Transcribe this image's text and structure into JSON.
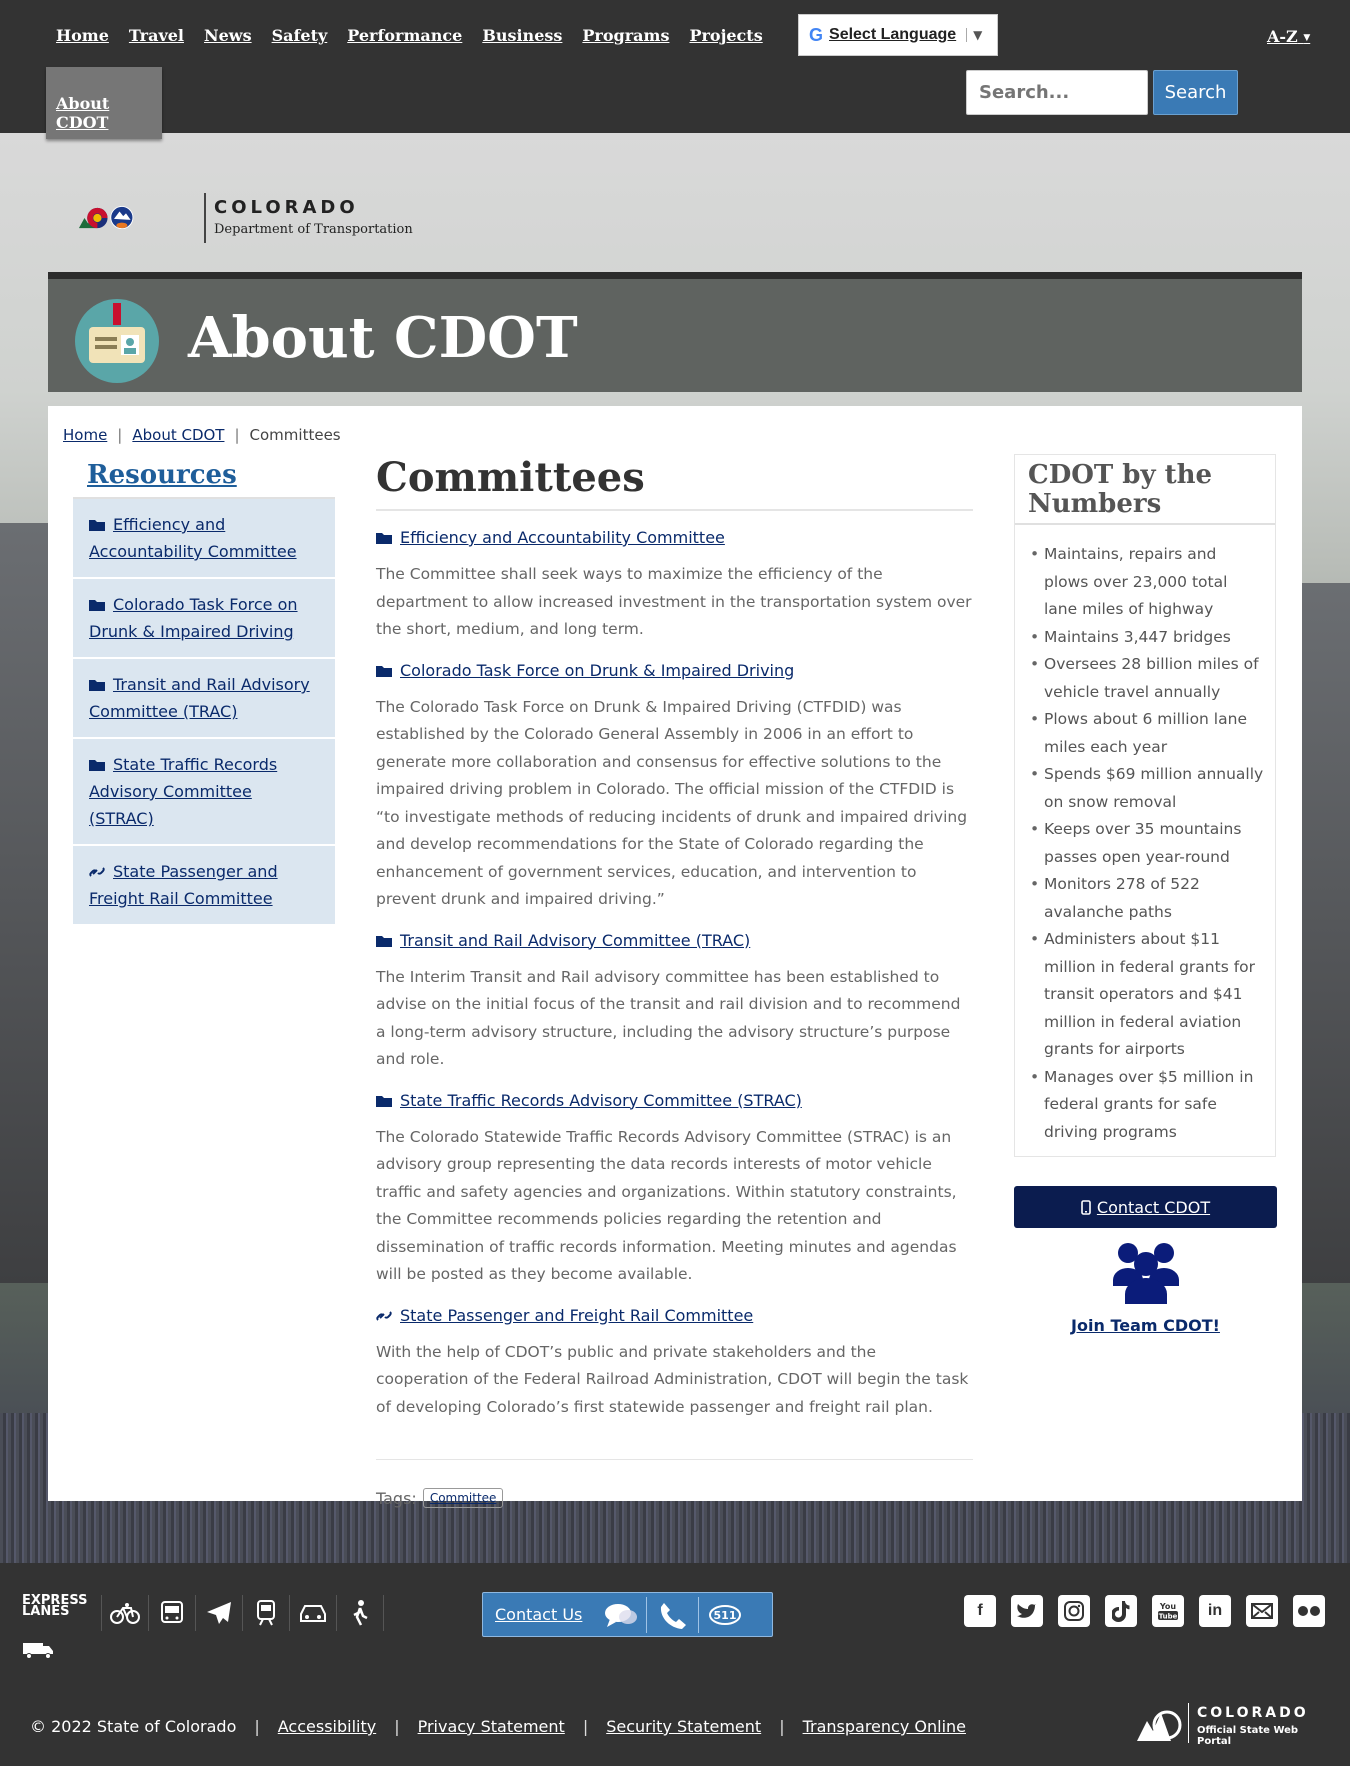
{
  "nav": {
    "links": [
      "Home",
      "Travel",
      "News",
      "Safety",
      "Performance",
      "Business",
      "Programs",
      "Projects"
    ],
    "active_tab": "About CDOT",
    "language_label": "Select Language",
    "az_label": "A-Z",
    "search_placeholder": "Search...",
    "search_button": "Search"
  },
  "logo": {
    "wordmark": "COLORADO",
    "department": "Department of Transportation"
  },
  "banner": {
    "title": "About CDOT"
  },
  "breadcrumb": {
    "home": "Home",
    "parent": "About CDOT",
    "current": "Committees"
  },
  "sidebar": {
    "heading": "Resources",
    "items": [
      {
        "label": "Efficiency and Accountability Committee",
        "icon": "folder-icon"
      },
      {
        "label": "Colorado Task Force on Drunk & Impaired Driving",
        "icon": "folder-icon"
      },
      {
        "label": "Transit and Rail Advisory Committee (TRAC)",
        "icon": "folder-icon"
      },
      {
        "label": "State Traffic Records Advisory Committee (STRAC)",
        "icon": "folder-icon"
      },
      {
        "label": "State Passenger and Freight Rail Committee",
        "icon": "link-icon"
      }
    ]
  },
  "main": {
    "title": "Committees",
    "sections": [
      {
        "title": "Efficiency and Accountability Committee",
        "icon": "folder-icon",
        "desc": "The Committee shall seek ways to maximize the efficiency of the department to allow increased investment in the transportation system over the short, medium, and long term."
      },
      {
        "title": "Colorado Task Force on Drunk & Impaired Driving",
        "icon": "folder-icon",
        "desc": "The Colorado Task Force on Drunk & Impaired Driving (CTFDID) was established by the Colorado General Assembly in 2006 in an effort to generate more collaboration and consensus for effective solutions to the impaired driving problem in Colorado. The official mission of the CTFDID is “to investigate methods of reducing incidents of drunk and impaired driving and develop recommendations for the State of Colorado regarding the enhancement of government services, education, and intervention to prevent drunk and impaired driving.”"
      },
      {
        "title": "Transit and Rail Advisory Committee (TRAC)",
        "icon": "folder-icon",
        "desc": "The Interim Transit and Rail advisory committee has been established to advise on the initial focus of the transit and rail division and to recommend a long-term advisory structure, including the advisory structure’s purpose and role."
      },
      {
        "title": "State Traffic Records Advisory Committee (STRAC)",
        "icon": "folder-icon",
        "desc": "The Colorado Statewide Traffic Records Advisory Committee (STRAC) is an advisory group representing the data records interests of motor vehicle traffic and safety agencies and organizations. Within statutory constraints, the Committee recommends policies regarding the retention and dissemination of traffic records information. Meeting minutes and agendas will be posted as they become available."
      },
      {
        "title": "State Passenger and Freight Rail Committee",
        "icon": "link-icon",
        "desc": "With the help of CDOT’s public and private stakeholders and the cooperation of the Federal Railroad Administration, CDOT will begin the task of developing Colorado’s first statewide passenger and freight rail plan."
      }
    ],
    "tags_label": "Tags:",
    "tags": [
      "Committee"
    ]
  },
  "numbers": {
    "heading": "CDOT by the Numbers",
    "items": [
      "Maintains, repairs and plows over 23,000 total lane miles of highway",
      "Maintains 3,447 bridges",
      "Oversees 28 billion miles of vehicle travel annually",
      "Plows about 6 million lane miles each year",
      "Spends $69 million annually on snow removal",
      "Keeps over 35 mountains passes open year-round",
      "Monitors 278 of 522 avalanche paths",
      "Administers about $11 million in federal grants for transit operators and $41 million in federal aviation grants for airports",
      "Manages over $5 million in federal grants for safe driving programs"
    ]
  },
  "contact_button": "Contact CDOT",
  "team_link": "Join Team CDOT!",
  "footer": {
    "express_lanes": "EXPRESS LANES",
    "contact_us": "Contact Us",
    "copyright": "© 2022 State of Colorado",
    "links": [
      "Accessibility",
      "Privacy Statement",
      "Security Statement",
      "Transparency Online"
    ],
    "state_wordmark": "COLORADO",
    "state_sub": "Official State Web Portal",
    "socials": [
      "facebook-icon",
      "twitter-icon",
      "instagram-icon",
      "tiktok-icon",
      "youtube-icon",
      "linkedin-icon",
      "email-icon",
      "flickr-icon"
    ]
  },
  "colors": {
    "nav_bg": "#333333",
    "link": "#0a2a6b",
    "accent": "#3a7ab5",
    "sidebar_item": "#dbe6f0",
    "contact_btn": "#0b1c4f"
  }
}
